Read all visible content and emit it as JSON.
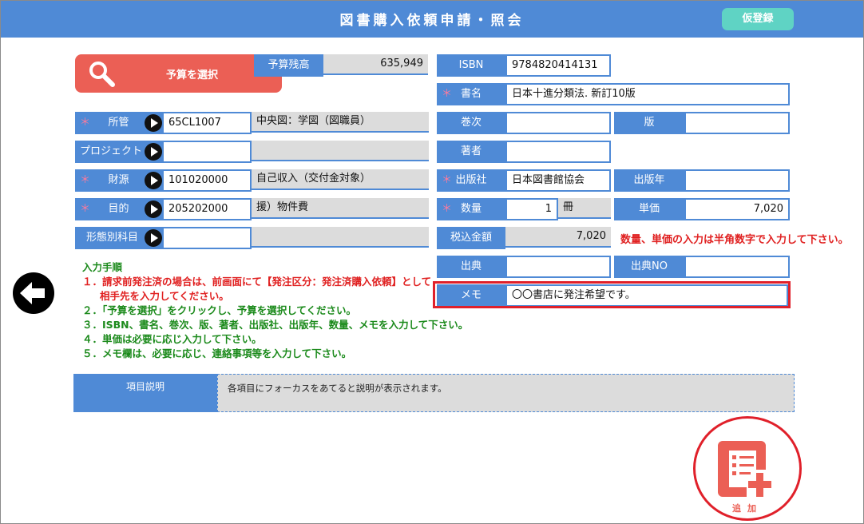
{
  "header": {
    "title": "図書購入依頼申請・照会",
    "provisional_label": "仮登録"
  },
  "budget": {
    "select_label": "予算を選択",
    "remaining_label": "予算残高",
    "remaining_value": "635,949"
  },
  "left_form": {
    "dept": {
      "label": "所管",
      "required": "＊",
      "code": "65CL1007",
      "name": "中央図：学図（図職員）"
    },
    "project": {
      "label": "プロジェクト",
      "code": "",
      "name": ""
    },
    "fund": {
      "label": "財源",
      "required": "＊",
      "code": "101020000",
      "name": "自己収入（交付金対象）"
    },
    "purpose": {
      "label": "目的",
      "required": "＊",
      "code": "205202000",
      "name": "援）物件費"
    },
    "account": {
      "label": "形態別科目",
      "code": "",
      "name": ""
    }
  },
  "right_form": {
    "isbn": {
      "label": "ISBN",
      "value": "9784820414131"
    },
    "title": {
      "label": "書名",
      "required": "＊",
      "value": "日本十進分類法. 新訂10版"
    },
    "volume": {
      "label": "巻次",
      "value": ""
    },
    "edition": {
      "label": "版",
      "value": ""
    },
    "author": {
      "label": "著者",
      "value": ""
    },
    "publisher": {
      "label": "出版社",
      "required": "＊",
      "value": "日本図書館協会"
    },
    "pub_year": {
      "label": "出版年",
      "value": ""
    },
    "quantity": {
      "label": "数量",
      "required": "＊",
      "value": "1",
      "unit": "冊"
    },
    "unit_price": {
      "label": "単価",
      "value": "7,020"
    },
    "total": {
      "label": "税込金額",
      "value": "7,020"
    },
    "source": {
      "label": "出典",
      "value": ""
    },
    "source_no": {
      "label": "出典NO",
      "value": ""
    },
    "memo": {
      "label": "メモ",
      "value": "〇〇書店に発注希望です。"
    }
  },
  "hint": "数量、単価の入力は半角数字で入力して下さい。",
  "instructions": {
    "heading": "入力手順",
    "step1a": "１．請求前発注済の場合は、前画面にて【発注区分：発注済購入依頼】として",
    "step1b": "相手先を入力してください。",
    "step2": "２．「予算を選択」をクリックし、予算を選択してください。",
    "step3": "３．ISBN、書名、巻次、版、著者、出版社、出版年、数量、メモを入力して下さい。",
    "step4": "４．単価は必要に応じ入力して下さい。",
    "step5": "５．メモ欄は、必要に応じ、連絡事項等を入力して下さい。"
  },
  "description": {
    "label": "項目説明",
    "text": "各項目にフォーカスをあてると説明が表示されます。"
  },
  "add": {
    "label": "追加"
  },
  "colors": {
    "header": "#4f8ad6",
    "accent": "#eb5f55",
    "highlight": "#e0202a",
    "provisional": "#5fd3c4"
  }
}
